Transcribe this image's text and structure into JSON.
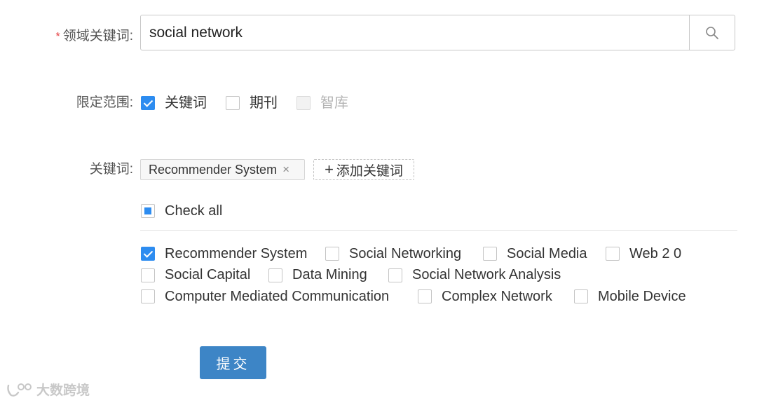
{
  "form": {
    "domain_keyword": {
      "label": "领域关键词:",
      "required_mark": "*",
      "value": "social network"
    },
    "scope": {
      "label": "限定范围:",
      "options": [
        {
          "label": "关键词",
          "checked": true,
          "disabled": false
        },
        {
          "label": "期刊",
          "checked": false,
          "disabled": false
        },
        {
          "label": "智库",
          "checked": false,
          "disabled": true
        }
      ]
    },
    "keywords": {
      "label": "关键词:",
      "tags": [
        "Recommender System"
      ],
      "tag_close": "×",
      "add_plus": "+",
      "add_label": "添加关键词"
    },
    "check_all": {
      "label": "Check all",
      "state": "indeterminate"
    },
    "keyword_options": [
      {
        "label": "Recommender System",
        "checked": true
      },
      {
        "label": "Social Networking",
        "checked": false
      },
      {
        "label": "Social Media",
        "checked": false
      },
      {
        "label": "Web 2 0",
        "checked": false
      },
      {
        "label": "Social Capital",
        "checked": false
      },
      {
        "label": "Data Mining",
        "checked": false
      },
      {
        "label": "Social Network Analysis",
        "checked": false
      },
      {
        "label": "Computer Mediated Communication",
        "checked": false
      },
      {
        "label": "Complex Network",
        "checked": false
      },
      {
        "label": "Mobile Device",
        "checked": false
      }
    ],
    "submit_label": "提交"
  },
  "watermark": {
    "text": "大数跨境"
  }
}
